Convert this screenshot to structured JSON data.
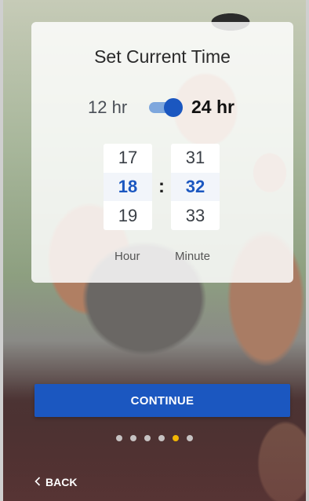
{
  "dialog": {
    "title": "Set Current Time",
    "format_12_label": "12 hr",
    "format_24_label": "24 hr",
    "format_24_selected": true,
    "hour": {
      "prev": "17",
      "selected": "18",
      "next": "19",
      "label": "Hour"
    },
    "separator": ":",
    "minute": {
      "prev": "31",
      "selected": "32",
      "next": "33",
      "label": "Minute"
    }
  },
  "continue_label": "CONTINUE",
  "pager": {
    "count": 6,
    "active_index": 4
  },
  "back_label": "BACK",
  "colors": {
    "accent": "#1b57c0",
    "active_dot": "#f2b705"
  },
  "icons": {
    "back": "chevron-left-icon"
  }
}
